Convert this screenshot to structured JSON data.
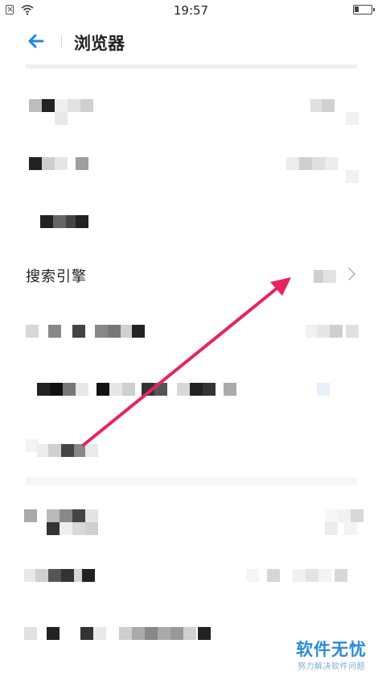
{
  "status_bar": {
    "time": "19:57"
  },
  "header": {
    "title": "浏览器"
  },
  "rows": {
    "search_engine": {
      "label": "搜索引擎"
    }
  },
  "watermark": {
    "brand": "软件无忧",
    "tagline": "努力解决软件问题"
  },
  "colors": {
    "accent": "#1e88e5",
    "arrow": "#e8235f",
    "watermark": "#2c8bd6"
  },
  "icons": [
    "sim-absent-icon",
    "wifi-icon",
    "battery-icon",
    "back-arrow-icon",
    "chevron-right-icon"
  ]
}
